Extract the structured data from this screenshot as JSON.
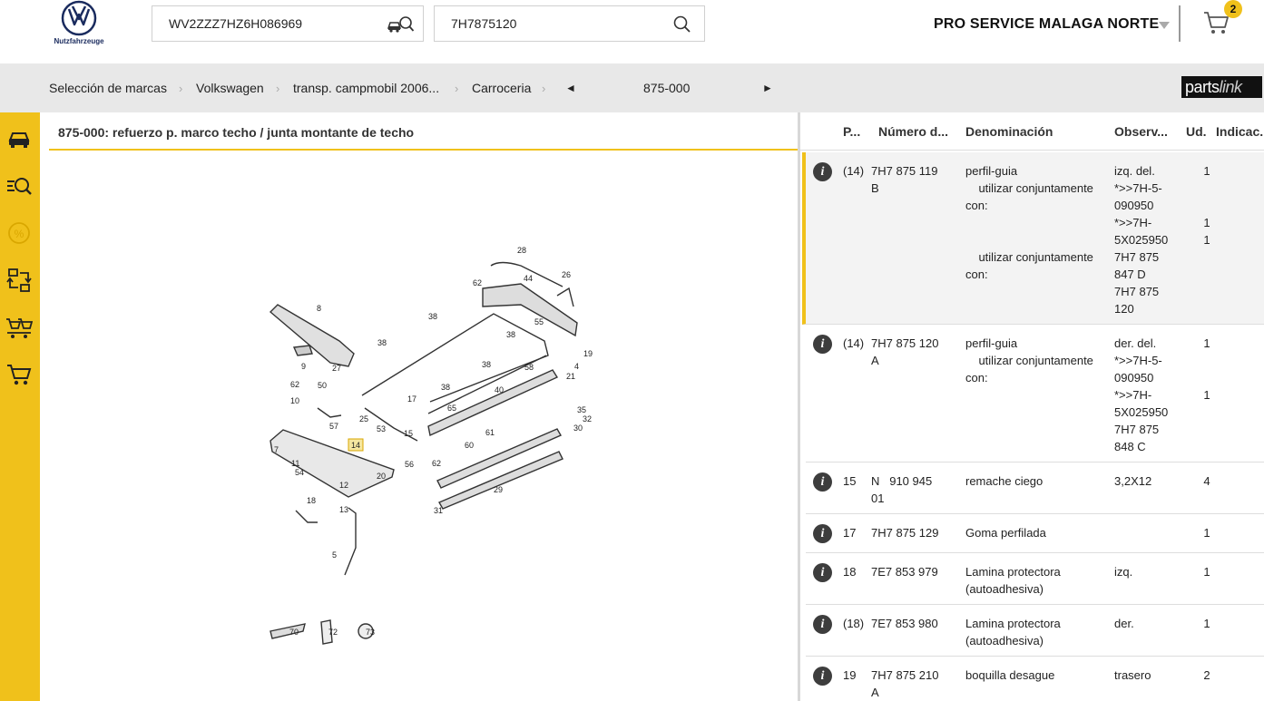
{
  "header": {
    "brand_sub": "Nutzfahrzeuge",
    "vin_value": "WV2ZZZ7HZ6H086969",
    "part_search_value": "7H7875120",
    "dealer_name": "PRO SERVICE MALAGA NORTE",
    "cart_count": "2"
  },
  "breadcrumb": {
    "items": [
      "Selección de marcas",
      "Volkswagen",
      "transp. campmobil 2006...",
      "Carroceria"
    ],
    "page_code": "875-000",
    "prev_symbol": "◄",
    "next_symbol": "►"
  },
  "partslink_logo": {
    "part1": "parts",
    "part2": "link"
  },
  "sidebar": {
    "icons": [
      "car-icon",
      "search-list-icon",
      "discount-icon",
      "exchange-icon",
      "multi-cart-icon",
      "cart-icon"
    ]
  },
  "diagram": {
    "title": "875-000: refuerzo p. marco techo / junta montante de techo",
    "callouts": [
      "28",
      "26",
      "62",
      "44",
      "8",
      "55",
      "38",
      "38",
      "38",
      "19",
      "4",
      "21",
      "9",
      "38",
      "58",
      "27",
      "62",
      "50",
      "17",
      "40",
      "10",
      "38",
      "35",
      "32",
      "57",
      "25",
      "65",
      "30",
      "53",
      "15",
      "61",
      "14",
      "60",
      "11",
      "56",
      "62",
      "54",
      "20",
      "12",
      "18",
      "29",
      "13",
      "5",
      "31",
      "70",
      "72",
      "73",
      "7"
    ]
  },
  "parts_table": {
    "columns": [
      "P...",
      "Número d...",
      "Denominación",
      "Observ...",
      "Ud.",
      "Indicac..."
    ],
    "rows": [
      {
        "pos": "(14)",
        "number": "7H7 875 119\nB",
        "denomination": "perfil-guia\n    utilizar conjuntamente\ncon:\n\n\n    utilizar conjuntamente\ncon:",
        "observation": "izq. del.\n*>>7H-5-\n090950\n*>>7H-\n5X025950\n7H7 875\n847 D\n7H7 875\n120",
        "qty": "1\n\n\n1\n1",
        "selected": true
      },
      {
        "pos": "(14)",
        "number": "7H7 875 120\nA",
        "denomination": "perfil-guia\n    utilizar conjuntamente\ncon:",
        "observation": "der. del.\n*>>7H-5-\n090950\n*>>7H-\n5X025950\n7H7 875\n848 C",
        "qty": "1\n\n\n1",
        "selected": false
      },
      {
        "pos": "15",
        "number": "N   910 945\n01",
        "denomination": "remache ciego",
        "observation": "3,2X12",
        "qty": "4",
        "selected": false
      },
      {
        "pos": "17",
        "number": "7H7 875 129",
        "denomination": "Goma perfilada",
        "observation": "",
        "qty": "1",
        "selected": false
      },
      {
        "pos": "18",
        "number": "7E7 853 979",
        "denomination": "Lamina protectora\n(autoadhesiva)",
        "observation": "izq.",
        "qty": "1",
        "selected": false
      },
      {
        "pos": "(18)",
        "number": "7E7 853 980",
        "denomination": "Lamina protectora\n(autoadhesiva)",
        "observation": "der.",
        "qty": "1",
        "selected": false
      },
      {
        "pos": "19",
        "number": "7H7 875 210\nA",
        "denomination": "boquilla desague",
        "observation": "trasero",
        "qty": "2",
        "selected": false
      }
    ]
  },
  "colors": {
    "accent": "#f0c11b",
    "breadcrumb_bg": "#e8e8e8",
    "info_icon": "#3d3d3d",
    "vw_blue": "#1a2b5e"
  }
}
